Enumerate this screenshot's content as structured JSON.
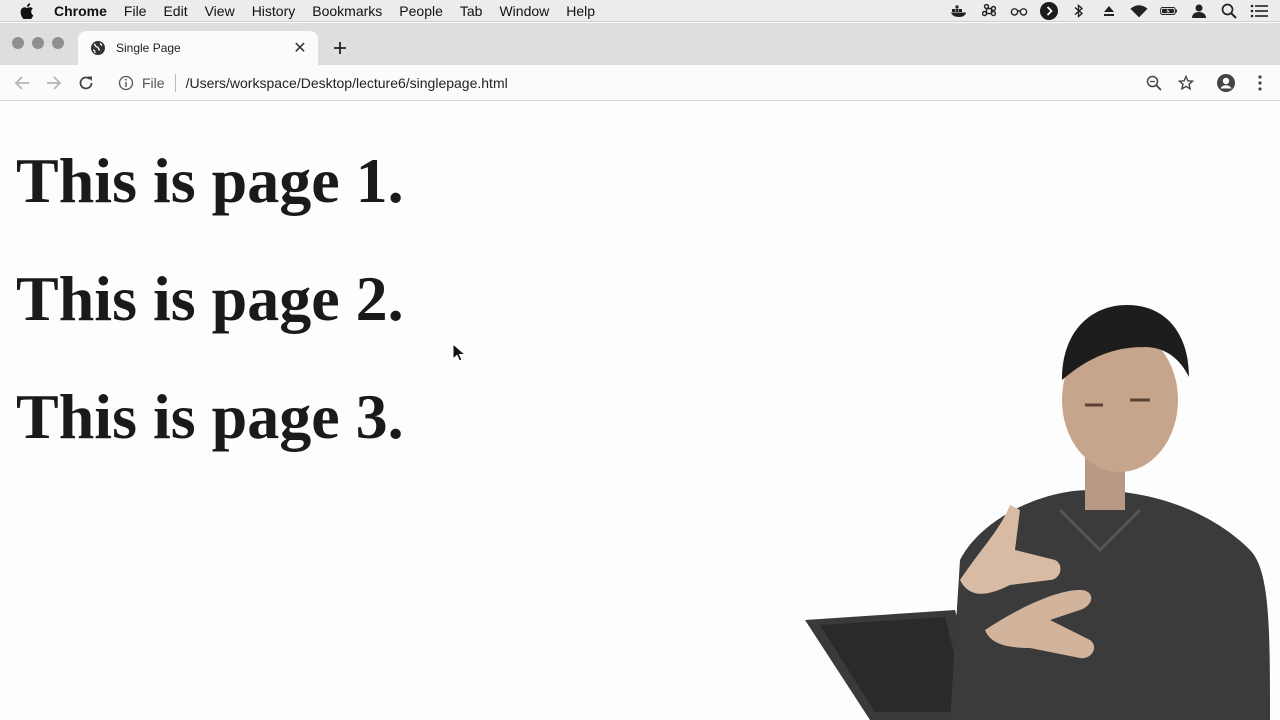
{
  "menubar": {
    "app_name": "Chrome",
    "items": [
      "File",
      "Edit",
      "View",
      "History",
      "Bookmarks",
      "People",
      "Tab",
      "Window",
      "Help"
    ],
    "status_icons": [
      "docker-icon",
      "command-icon",
      "glasses-icon",
      "play-circle-icon",
      "bluetooth-icon",
      "eject-icon",
      "wifi-icon",
      "battery-icon",
      "user-icon",
      "spotlight-search-icon",
      "list-icon"
    ]
  },
  "tab": {
    "title": "Single Page",
    "favicon": "globe-icon",
    "close_glyph": "✕"
  },
  "toolbar": {
    "scheme_label": "File",
    "url": "/Users/workspace/Desktop/lecture6/singlepage.html"
  },
  "page": {
    "headings": [
      "This is page 1.",
      "This is page 2.",
      "This is page 3."
    ]
  },
  "colors": {
    "menubar_bg": "#ececec",
    "tabstrip_bg": "#dedede",
    "tab_bg": "#fbfbfb",
    "page_bg": "#fdfdfd",
    "heading_text": "#1a1a1a"
  }
}
